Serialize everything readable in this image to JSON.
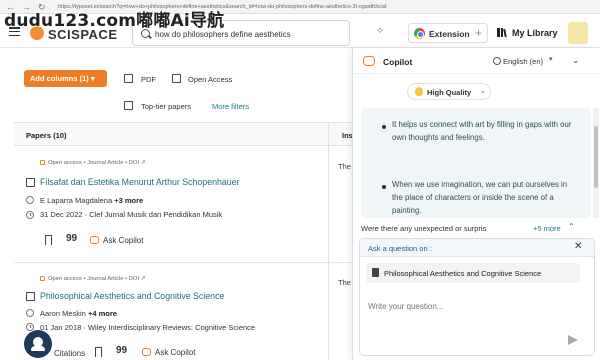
{
  "browser": {
    "url": "https://typeset.io/search?q=how+do+philosophers+define+aesthetics&search_id=how-do-philosophers-define-aesthetics-3t-ogwdfckcat",
    "back": "←",
    "forward": "→",
    "reload": "↻"
  },
  "watermark": "dudu123.com嘟嘟Ai导航",
  "header": {
    "logo": "SCISPACE",
    "search_value": "how do philosophers define aesthetics",
    "extension_label": "Extension",
    "extension_plus": "+",
    "library_label": "My Library"
  },
  "controls": {
    "add_columns": "Add columns (1) ▾",
    "pdf": "PDF",
    "open_access": "Open Access",
    "top_tier": "Top-tier papers",
    "more_filters": "More filters"
  },
  "table": {
    "papers_header": "Papers (10)",
    "insights_header": "Insi"
  },
  "papers": [
    {
      "meta": "Open access • Journal Article • DOI",
      "title": "Filsafat dan Estetika Menurut Arthur Schopenhauer",
      "authors": "E Laparra Magdalena",
      "more": "+3 more",
      "date": "31 Dec 2022 · Clef Jurnal Musik dan Pendidikan Musik",
      "insight": "The",
      "bookmark": "",
      "quote": "99",
      "ask": "Ask Copilot"
    },
    {
      "meta": "Open access • Journal Article • DOI",
      "title": "Philosophical Aesthetics and Cognitive Science",
      "authors": "Aaron Meskin",
      "more": "+4 more",
      "date": "01 Jan 2018 · Wiley Interdisciplinary Reviews: Cognitive Science",
      "insight": "The",
      "citations": "Citations",
      "quote": "99",
      "ask": "Ask Copilot"
    }
  ],
  "copilot": {
    "title": "Copilot",
    "language": "English (en)",
    "quality": "High Quality",
    "answer": [
      "It helps us connect with art by filling in gaps with our own thoughts and feelings.",
      "When we use imagination, we can put ourselves in the place of characters or inside the scene of a painting."
    ],
    "followup_question": "Were there any unexpected or surpris",
    "more_label": "+5 more",
    "ask_label": "Ask a question on :",
    "context_paper": "Philosophical Aesthetics and Cognitive Science",
    "question_placeholder": "Write your question..."
  },
  "colors": {
    "accent_orange": "#f07c26",
    "link_teal": "#1f6f7d",
    "answer_bg": "#f0f6f7"
  }
}
